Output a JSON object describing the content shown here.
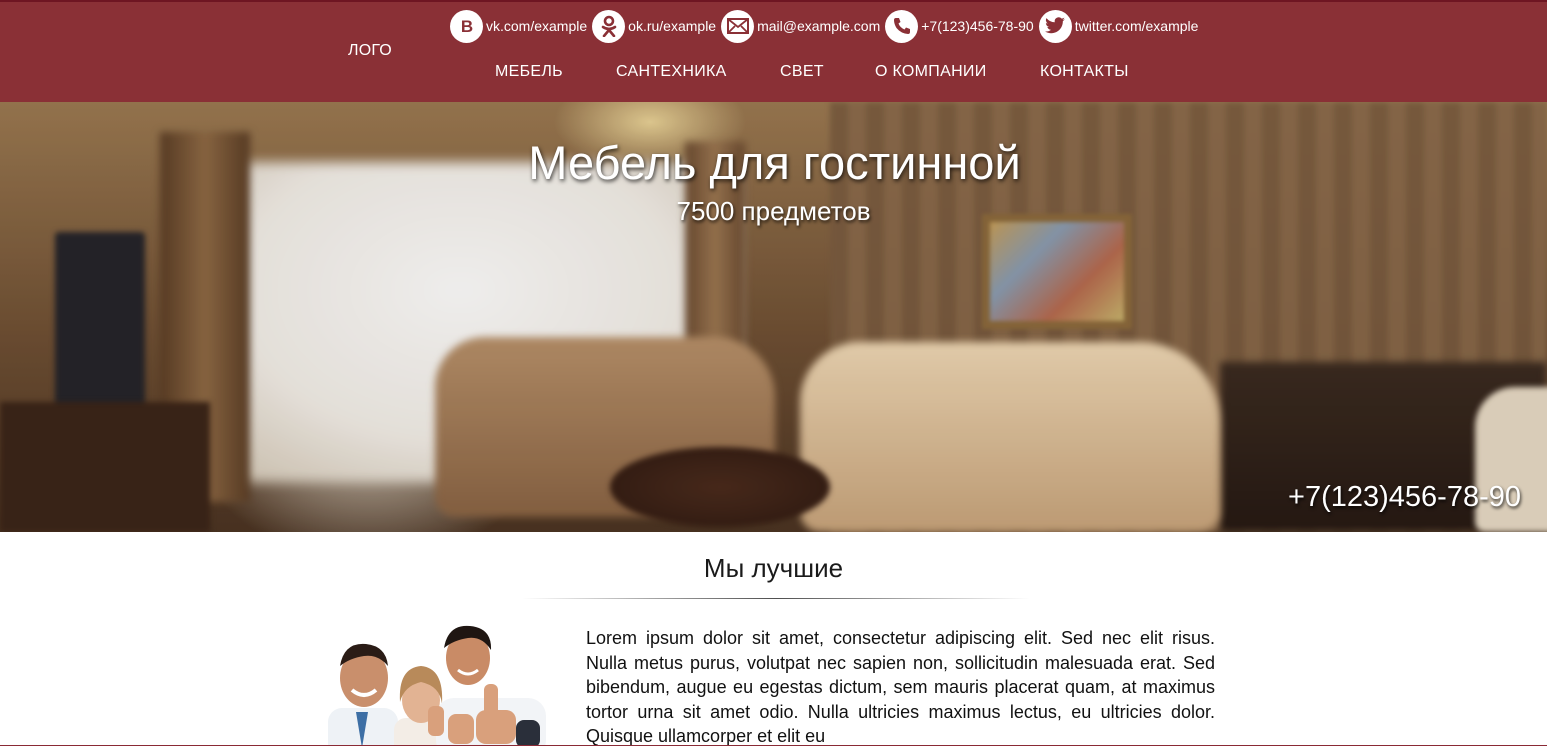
{
  "header": {
    "logo": "ЛОГО",
    "contacts": [
      {
        "icon": "vk-icon",
        "text": "vk.com/example"
      },
      {
        "icon": "odnoklassniki-icon",
        "text": "ok.ru/example"
      },
      {
        "icon": "mail-icon",
        "text": "mail@example.com"
      },
      {
        "icon": "phone-icon",
        "text": "+7(123)456-78-90"
      },
      {
        "icon": "twitter-icon",
        "text": "twitter.com/example"
      }
    ],
    "nav": [
      "МЕБЕЛЬ",
      "САНТЕХНИКА",
      "СВЕТ",
      "О КОМПАНИИ",
      "КОНТАКТЫ"
    ]
  },
  "hero": {
    "title": "Мебель для гостинной",
    "subtitle": "7500 предметов",
    "phone": "+7(123)456-78-90"
  },
  "about": {
    "title": "Мы лучшие",
    "text": "Lorem ipsum dolor sit amet, consectetur adipiscing elit. Sed nec elit risus. Nulla metus purus, volutpat nec sapien non, sollicitudin malesuada erat. Sed bibendum, augue eu egestas dictum, sem mauris placerat quam, at maximus tortor urna sit amet odio. Nulla ultricies maximus lectus, eu ultricies dolor. Quisque ullamcorper et elit eu"
  },
  "colors": {
    "header_bg": "#8a3036",
    "text_light": "#ffffff"
  }
}
